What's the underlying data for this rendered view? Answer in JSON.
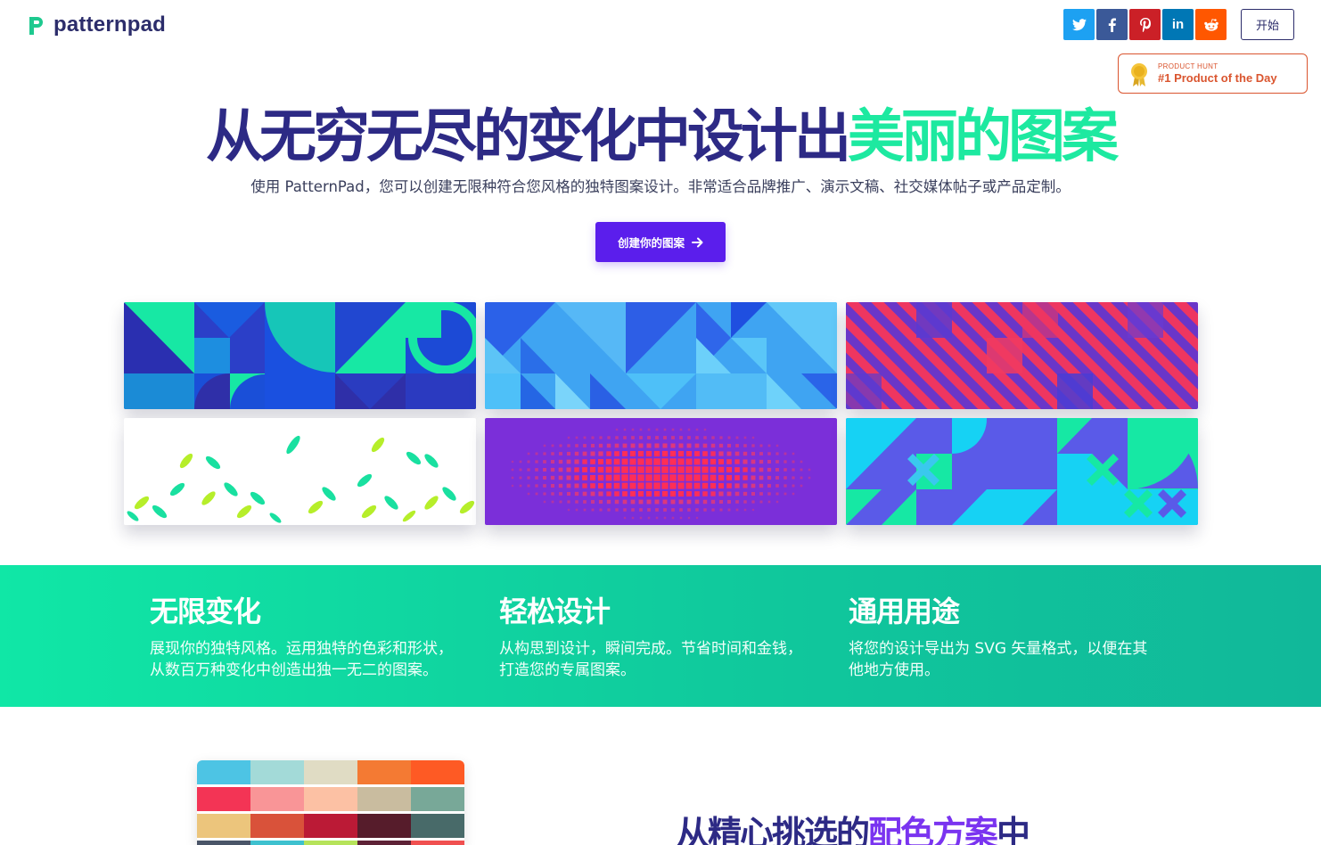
{
  "brand": {
    "name": "patternpad"
  },
  "social": [
    {
      "name": "twitter",
      "glyph": "t",
      "color": "#1da1f2"
    },
    {
      "name": "facebook",
      "glyph": "f",
      "color": "#3b5998"
    },
    {
      "name": "pinterest",
      "glyph": "p",
      "color": "#cb2027"
    },
    {
      "name": "linkedin",
      "glyph": "in",
      "color": "#0077b5"
    },
    {
      "name": "reddit",
      "glyph": "r",
      "color": "#ff5700"
    }
  ],
  "header": {
    "start_label": "开始"
  },
  "product_hunt": {
    "small": "PRODUCT HUNT",
    "big": "#1 Product of the Day"
  },
  "hero": {
    "title_main": "从无穷无尽的变化中设计出",
    "title_accent": "美丽的图案",
    "subtitle": "使用 PatternPad，您可以创建无限种符合您风格的独特图案设计。非常适合品牌推广、演示文稿、社交媒体帖子或产品定制。",
    "cta_label": "创建你的图案"
  },
  "features": [
    {
      "title": "无限变化",
      "text_line1": "展现你的独特风格。运用独特的色彩和形状，",
      "text_line2": "从数百万种变化中创造出独一无二的图案。"
    },
    {
      "title": "轻松设计",
      "text_line1": "从构思到设计，瞬间完成。节省时间和金钱，",
      "text_line2": "打造您的专属图案。"
    },
    {
      "title": "通用用途",
      "text_line1": "将您的设计导出为 SVG 矢量格式，以便在其",
      "text_line2": "他地方使用。"
    }
  ],
  "palette": {
    "colors": [
      "#4dc4e4",
      "#a3dad8",
      "#e0dcc4",
      "#f47a33",
      "#fe5a24",
      "#f33455",
      "#f99597",
      "#fcc1a4",
      "#c9bc9f",
      "#78a898",
      "#ecc57c",
      "#d9523a",
      "#bb1a36",
      "#561c2b",
      "#486a69"
    ],
    "title_main": "从精心挑选的",
    "title_accent": "配色方案",
    "title_end": "中"
  },
  "colors": {
    "navy": "#2d2a85",
    "mint": "#1de9a0",
    "purple": "#5b1eec",
    "ph_orange": "#da552f"
  }
}
